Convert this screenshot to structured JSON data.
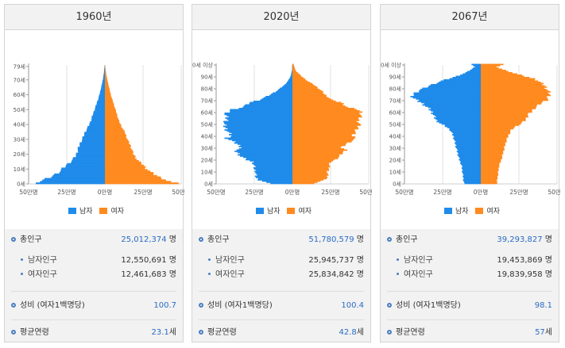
{
  "legend": {
    "male_label": "남자",
    "female_label": "여자"
  },
  "colors": {
    "male": "#1f8bea",
    "female": "#ff8a1f"
  },
  "panels": [
    {
      "year": "1960년",
      "stats": {
        "total_label": "총인구",
        "total_value": "25,012,374",
        "total_unit": "명",
        "male_label": "남자인구",
        "male_value": "12,550,691",
        "male_unit": "명",
        "female_label": "여자인구",
        "female_value": "12,461,683",
        "female_unit": "명",
        "ratio_label": "성비 (여자1백명당)",
        "ratio_value": "100.7",
        "age_label": "평균연령",
        "age_value": "23.1",
        "age_unit": "세"
      }
    },
    {
      "year": "2020년",
      "stats": {
        "total_label": "총인구",
        "total_value": "51,780,579",
        "total_unit": "명",
        "male_label": "남자인구",
        "male_value": "25,945,737",
        "male_unit": "명",
        "female_label": "여자인구",
        "female_value": "25,834,842",
        "female_unit": "명",
        "ratio_label": "성비 (여자1백명당)",
        "ratio_value": "100.4",
        "age_label": "평균연령",
        "age_value": "42.8",
        "age_unit": "세"
      }
    },
    {
      "year": "2067년",
      "stats": {
        "total_label": "총인구",
        "total_value": "39,293,827",
        "total_unit": "명",
        "male_label": "남자인구",
        "male_value": "19,453,869",
        "male_unit": "명",
        "female_label": "여자인구",
        "female_value": "19,839,958",
        "female_unit": "명",
        "ratio_label": "성비 (여자1백명당)",
        "ratio_value": "98.1",
        "age_label": "평균연령",
        "age_value": "57",
        "age_unit": "세"
      }
    }
  ],
  "chart_data": [
    {
      "type": "bar",
      "orientation": "horizontal-pyramid",
      "xlabel": "",
      "ylabel": "",
      "xlim": [
        -500000,
        500000
      ],
      "ylim": [
        0,
        80
      ],
      "grid": true,
      "x_tick_labels": [
        "50만명",
        "25만명",
        "0만명",
        "25만명",
        "50만명"
      ],
      "y_tick_labels": [
        "0세",
        "10세",
        "20세",
        "30세",
        "40세",
        "50세",
        "60세",
        "70세",
        "79세"
      ],
      "y_ticks": [
        0,
        10,
        20,
        30,
        40,
        50,
        60,
        70,
        79
      ],
      "age_max": 79,
      "male_anchors": [
        [
          0,
          470000
        ],
        [
          1,
          430000
        ],
        [
          2,
          405000
        ],
        [
          4,
          360000
        ],
        [
          6,
          325000
        ],
        [
          8,
          295000
        ],
        [
          10,
          275000
        ],
        [
          12,
          255000
        ],
        [
          14,
          230000
        ],
        [
          16,
          210000
        ],
        [
          18,
          195000
        ],
        [
          20,
          185000
        ],
        [
          22,
          180000
        ],
        [
          24,
          172000
        ],
        [
          26,
          166000
        ],
        [
          28,
          157000
        ],
        [
          30,
          146000
        ],
        [
          34,
          132000
        ],
        [
          38,
          110000
        ],
        [
          42,
          92000
        ],
        [
          46,
          80000
        ],
        [
          50,
          66000
        ],
        [
          54,
          53000
        ],
        [
          58,
          40000
        ],
        [
          62,
          30000
        ],
        [
          66,
          21000
        ],
        [
          70,
          13000
        ],
        [
          74,
          7000
        ],
        [
          79,
          2000
        ]
      ],
      "female_anchors": [
        [
          0,
          470000
        ],
        [
          1,
          430000
        ],
        [
          2,
          405000
        ],
        [
          4,
          360000
        ],
        [
          6,
          325000
        ],
        [
          8,
          295000
        ],
        [
          10,
          270000
        ],
        [
          12,
          255000
        ],
        [
          14,
          232000
        ],
        [
          16,
          210000
        ],
        [
          18,
          198000
        ],
        [
          20,
          185000
        ],
        [
          22,
          180000
        ],
        [
          24,
          172000
        ],
        [
          26,
          165000
        ],
        [
          28,
          155000
        ],
        [
          30,
          146000
        ],
        [
          34,
          132000
        ],
        [
          38,
          110000
        ],
        [
          42,
          92000
        ],
        [
          46,
          80000
        ],
        [
          50,
          68000
        ],
        [
          54,
          56000
        ],
        [
          58,
          43000
        ],
        [
          62,
          33000
        ],
        [
          66,
          24000
        ],
        [
          70,
          15000
        ],
        [
          74,
          8000
        ],
        [
          79,
          2000
        ]
      ]
    },
    {
      "type": "bar",
      "orientation": "horizontal-pyramid",
      "xlabel": "",
      "ylabel": "",
      "xlim": [
        -500000,
        500000
      ],
      "ylim": [
        0,
        100
      ],
      "grid": true,
      "x_tick_labels": [
        "50만명",
        "25만명",
        "0만명",
        "25만명",
        "50만명"
      ],
      "y_tick_labels": [
        "0세",
        "10세",
        "20세",
        "30세",
        "40세",
        "50세",
        "60세",
        "70세",
        "80세",
        "90세",
        "100세 이상"
      ],
      "y_ticks": [
        0,
        10,
        20,
        30,
        40,
        50,
        60,
        70,
        80,
        90,
        100
      ],
      "age_max": 100,
      "male_anchors": [
        [
          0,
          150000
        ],
        [
          3,
          220000
        ],
        [
          5,
          240000
        ],
        [
          8,
          240000
        ],
        [
          10,
          240000
        ],
        [
          12,
          250000
        ],
        [
          15,
          250000
        ],
        [
          18,
          260000
        ],
        [
          20,
          300000
        ],
        [
          23,
          340000
        ],
        [
          26,
          360000
        ],
        [
          28,
          380000
        ],
        [
          30,
          330000
        ],
        [
          33,
          360000
        ],
        [
          36,
          400000
        ],
        [
          38,
          430000
        ],
        [
          40,
          400000
        ],
        [
          43,
          420000
        ],
        [
          45,
          430000
        ],
        [
          47,
          440000
        ],
        [
          50,
          450000
        ],
        [
          53,
          430000
        ],
        [
          55,
          430000
        ],
        [
          58,
          440000
        ],
        [
          60,
          420000
        ],
        [
          62,
          400000
        ],
        [
          64,
          330000
        ],
        [
          66,
          300000
        ],
        [
          68,
          280000
        ],
        [
          70,
          220000
        ],
        [
          73,
          170000
        ],
        [
          75,
          140000
        ],
        [
          78,
          100000
        ],
        [
          80,
          80000
        ],
        [
          83,
          50000
        ],
        [
          86,
          30000
        ],
        [
          90,
          12000
        ],
        [
          95,
          3000
        ],
        [
          100,
          1000
        ]
      ],
      "female_anchors": [
        [
          0,
          140000
        ],
        [
          3,
          210000
        ],
        [
          5,
          230000
        ],
        [
          8,
          230000
        ],
        [
          10,
          230000
        ],
        [
          12,
          240000
        ],
        [
          15,
          240000
        ],
        [
          18,
          250000
        ],
        [
          20,
          280000
        ],
        [
          23,
          310000
        ],
        [
          26,
          330000
        ],
        [
          28,
          350000
        ],
        [
          30,
          320000
        ],
        [
          33,
          350000
        ],
        [
          36,
          390000
        ],
        [
          38,
          420000
        ],
        [
          40,
          390000
        ],
        [
          43,
          410000
        ],
        [
          45,
          420000
        ],
        [
          47,
          430000
        ],
        [
          50,
          440000
        ],
        [
          53,
          430000
        ],
        [
          55,
          440000
        ],
        [
          58,
          450000
        ],
        [
          60,
          450000
        ],
        [
          62,
          430000
        ],
        [
          64,
          360000
        ],
        [
          66,
          340000
        ],
        [
          68,
          320000
        ],
        [
          70,
          260000
        ],
        [
          73,
          230000
        ],
        [
          75,
          210000
        ],
        [
          78,
          190000
        ],
        [
          80,
          170000
        ],
        [
          83,
          140000
        ],
        [
          86,
          100000
        ],
        [
          90,
          60000
        ],
        [
          95,
          20000
        ],
        [
          100,
          8000
        ]
      ]
    },
    {
      "type": "bar",
      "orientation": "horizontal-pyramid",
      "xlabel": "",
      "ylabel": "",
      "xlim": [
        -500000,
        500000
      ],
      "ylim": [
        0,
        100
      ],
      "grid": true,
      "x_tick_labels": [
        "50만명",
        "25만명",
        "0만명",
        "25만명",
        "50만명"
      ],
      "y_tick_labels": [
        "0세",
        "10세",
        "20세",
        "30세",
        "40세",
        "50세",
        "60세",
        "70세",
        "80세",
        "90세",
        "100세 이상"
      ],
      "y_ticks": [
        0,
        10,
        20,
        30,
        40,
        50,
        60,
        70,
        80,
        90,
        100
      ],
      "age_max": 100,
      "male_anchors": [
        [
          0,
          110000
        ],
        [
          5,
          115000
        ],
        [
          10,
          120000
        ],
        [
          15,
          125000
        ],
        [
          20,
          140000
        ],
        [
          25,
          150000
        ],
        [
          30,
          160000
        ],
        [
          35,
          170000
        ],
        [
          40,
          180000
        ],
        [
          45,
          200000
        ],
        [
          48,
          230000
        ],
        [
          50,
          260000
        ],
        [
          53,
          290000
        ],
        [
          55,
          300000
        ],
        [
          58,
          310000
        ],
        [
          60,
          320000
        ],
        [
          63,
          340000
        ],
        [
          65,
          360000
        ],
        [
          68,
          390000
        ],
        [
          70,
          420000
        ],
        [
          72,
          440000
        ],
        [
          74,
          450000
        ],
        [
          76,
          430000
        ],
        [
          78,
          410000
        ],
        [
          80,
          370000
        ],
        [
          82,
          340000
        ],
        [
          84,
          300000
        ],
        [
          86,
          260000
        ],
        [
          88,
          210000
        ],
        [
          90,
          160000
        ],
        [
          93,
          100000
        ],
        [
          96,
          60000
        ],
        [
          98,
          40000
        ],
        [
          100,
          60000
        ]
      ],
      "female_anchors": [
        [
          0,
          105000
        ],
        [
          5,
          110000
        ],
        [
          10,
          115000
        ],
        [
          15,
          120000
        ],
        [
          20,
          135000
        ],
        [
          25,
          145000
        ],
        [
          30,
          155000
        ],
        [
          35,
          165000
        ],
        [
          40,
          180000
        ],
        [
          45,
          200000
        ],
        [
          48,
          230000
        ],
        [
          50,
          260000
        ],
        [
          53,
          290000
        ],
        [
          55,
          300000
        ],
        [
          58,
          310000
        ],
        [
          60,
          330000
        ],
        [
          63,
          350000
        ],
        [
          65,
          370000
        ],
        [
          68,
          400000
        ],
        [
          70,
          430000
        ],
        [
          72,
          440000
        ],
        [
          74,
          450000
        ],
        [
          76,
          450000
        ],
        [
          78,
          440000
        ],
        [
          80,
          430000
        ],
        [
          82,
          420000
        ],
        [
          84,
          400000
        ],
        [
          86,
          380000
        ],
        [
          88,
          350000
        ],
        [
          90,
          290000
        ],
        [
          93,
          210000
        ],
        [
          96,
          140000
        ],
        [
          98,
          100000
        ],
        [
          100,
          150000
        ]
      ]
    }
  ]
}
